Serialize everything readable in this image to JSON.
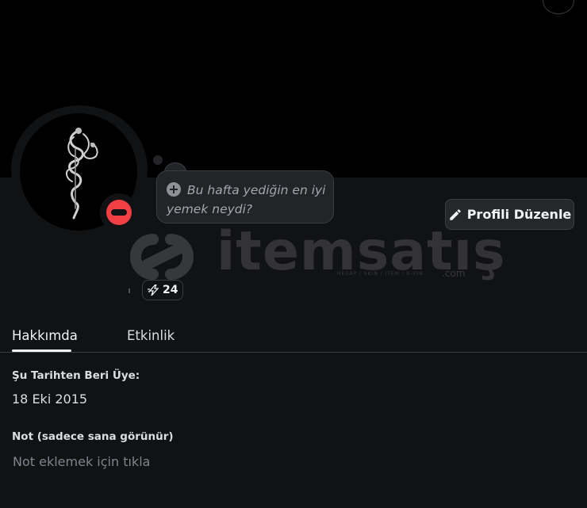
{
  "status": {
    "thought_bubble_text": "Bu hafta yediğin en iyi yemek neydi?",
    "presence": "dnd",
    "presence_color": "#f23f43"
  },
  "profile": {
    "edit_button_label": "Profili Düzenle",
    "badge_count": "24"
  },
  "watermark": {
    "brand": "itemsatış",
    "subtitle": "HESAP / SKIN / ITEM / E-PIN",
    "suffix": ".com"
  },
  "tabs": [
    {
      "label": "Hakkımda",
      "active": true
    },
    {
      "label": "Etkinlik",
      "active": false
    }
  ],
  "about": {
    "member_since_title": "Şu Tarihten Beri Üye:",
    "member_since_value": "18 Eki 2015",
    "note_title": "Not (sadece sana görünür)",
    "note_placeholder": "Not eklemek için tıkla"
  },
  "icons": {
    "edit": "pencil-icon",
    "add_status": "plus-circle-icon",
    "badge": "lightning-icon"
  },
  "colors": {
    "background": "#111214",
    "banner": "#000000",
    "card": "#232428"
  }
}
